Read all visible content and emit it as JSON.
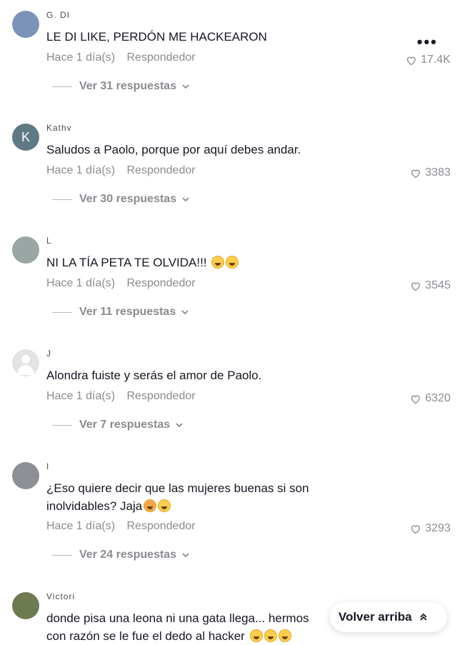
{
  "comments": [
    {
      "username": "G. DI",
      "text": "LE DI LIKE, PERDÓN ME HACKEARON",
      "time": "Hace 1 día(s)",
      "reply_label": "Respondedor",
      "likes": "17.4K",
      "replies_label": "Ver 31 respuestas",
      "avatar_color": "#7c93b8"
    },
    {
      "username": "Kathy",
      "avatar_letter": "K",
      "text": "Saludos a Paolo, porque por aquí debes andar.",
      "time": "Hace 1 día(s)",
      "reply_label": "Respondedor",
      "likes": "3383",
      "replies_label": "Ver 30 respuestas",
      "avatar_color": "#5f7a86"
    },
    {
      "username": "L",
      "text": "NI LA TÍA PETA TE OLVIDA!!! ",
      "time": "Hace 1 día(s)",
      "reply_label": "Respondedor",
      "likes": "3545",
      "replies_label": "Ver 11 respuestas",
      "avatar_color": "#9aa6a4"
    },
    {
      "username": "J",
      "text": "Alondra fuiste y serás el amor de Paolo.",
      "time": "Hace 1 día(s)",
      "reply_label": "Respondedor",
      "likes": "6320",
      "replies_label": "Ver 7 respuestas",
      "avatar_color": "#e3e3e4"
    },
    {
      "username": "I",
      "text_line1": "¿Eso quiere decir que las mujeres buenas si son",
      "text_line2": "inolvidables? Jaja",
      "time": "Hace 1 día(s)",
      "reply_label": "Respondedor",
      "likes": "3293",
      "replies_label": "Ver 24 respuestas",
      "avatar_color": "#8d8f95"
    },
    {
      "username": "Victori",
      "text_line1": "donde pisa una leona ni una gata llega... hermos",
      "text_line2": "con razón se le fue el dedo al hacker ",
      "avatar_color": "#6e7b52"
    }
  ],
  "more_icon_label": "•••",
  "back_to_top": "Volver arriba",
  "colors": {
    "text": "#161823",
    "muted": "#8a8b91"
  },
  "icons": [
    "heart-outline-icon",
    "chevron-down-icon",
    "more-icon",
    "double-chevron-up-icon"
  ]
}
